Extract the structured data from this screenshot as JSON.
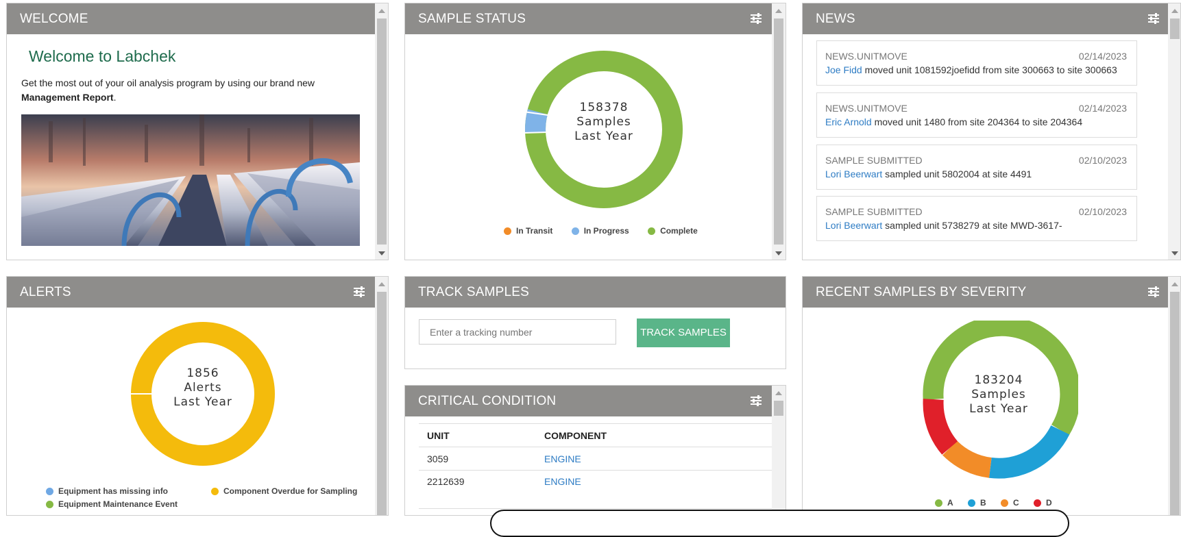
{
  "welcome": {
    "title": "WELCOME",
    "heading": "Welcome to Labchek",
    "intro": "Get the most out of your oil analysis program by using our brand new",
    "link_text": "Management Report",
    "link_suffix": "."
  },
  "sample_status": {
    "title": "SAMPLE STATUS",
    "center": [
      "158378",
      "Samples",
      "Last Year"
    ],
    "legend": [
      {
        "label": "In Transit",
        "color": "#f28c28"
      },
      {
        "label": "In Progress",
        "color": "#7fb3e8"
      },
      {
        "label": "Complete",
        "color": "#86b944"
      }
    ]
  },
  "news": {
    "title": "NEWS",
    "items": [
      {
        "type": "NEWS.UNITMOVE",
        "date": "02/14/2023",
        "user": "Joe Fidd",
        "text": " moved unit 1081592joefidd from site 300663 to site 300663"
      },
      {
        "type": "NEWS.UNITMOVE",
        "date": "02/14/2023",
        "user": "Eric Arnold",
        "text": " moved unit 1480 from site 204364 to site 204364"
      },
      {
        "type": "SAMPLE SUBMITTED",
        "date": "02/10/2023",
        "user": "Lori Beerwart",
        "text": " sampled unit 5802004 at site 4491"
      },
      {
        "type": "SAMPLE SUBMITTED",
        "date": "02/10/2023",
        "user": "Lori Beerwart",
        "text": " sampled unit 5738279 at site MWD-3617-"
      }
    ]
  },
  "alerts": {
    "title": "ALERTS",
    "center": [
      "1856",
      "Alerts",
      "Last Year"
    ],
    "legend": [
      {
        "label": "Equipment has missing info",
        "color": "#6fa8e4"
      },
      {
        "label": "Component Overdue for Sampling",
        "color": "#f4bb0c"
      },
      {
        "label": "Equipment Maintenance Event",
        "color": "#86b944"
      }
    ]
  },
  "track": {
    "title": "TRACK SAMPLES",
    "placeholder": "Enter a tracking number",
    "button": "TRACK SAMPLES"
  },
  "critical": {
    "title": "CRITICAL CONDITION",
    "columns": [
      "UNIT",
      "COMPONENT"
    ],
    "rows": [
      {
        "unit": "3059",
        "component": "ENGINE"
      },
      {
        "unit": "2212639",
        "component": "ENGINE"
      }
    ]
  },
  "severity": {
    "title": "RECENT SAMPLES BY SEVERITY",
    "center": [
      "183204",
      "Samples",
      "Last Year"
    ],
    "legend": [
      {
        "label": "A",
        "color": "#86b944"
      },
      {
        "label": "B",
        "color": "#1fa0d6"
      },
      {
        "label": "C",
        "color": "#f28c28"
      },
      {
        "label": "D",
        "color": "#e0202a"
      }
    ]
  }
}
